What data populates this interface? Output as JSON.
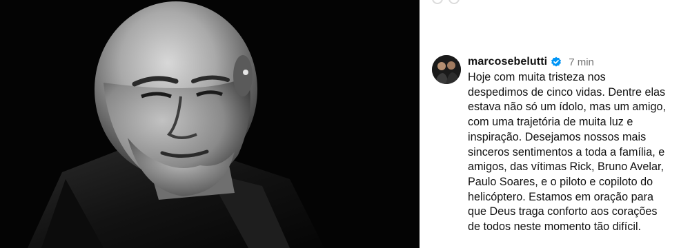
{
  "post": {
    "photo_alt": "Black and white portrait of a bald man with a grey beard wearing a dark leather jacket",
    "colors": {
      "verified_badge": "#0095f6",
      "timestamp": "#737373",
      "text": "#111111"
    }
  },
  "comment": {
    "username": "marcosebelutti",
    "timestamp": "7 min",
    "verified_icon": "verified-badge-icon",
    "caption": "Hoje com muita tristeza nos\ndespedimos de cinco vidas. Dentre elas\nestava não só um ídolo, mas um amigo,\ncom uma trajetória de muita luz e\ninspiração. Desejamos nossos mais\nsinceros sentimentos a toda a família, e\namigos, das vítimas Rick, Bruno Avelar,\nPaulo Soares, e o piloto e copiloto do\nhelicóptero. Estamos em oração para\nque Deus traga conforto aos corações\nde todos neste momento tão difícil."
  }
}
